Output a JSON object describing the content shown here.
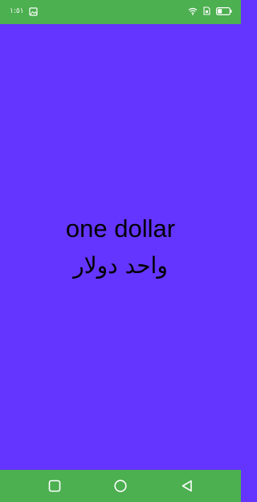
{
  "status_bar": {
    "time": "١:٥١",
    "icons": [
      "image-icon",
      "wifi-icon",
      "sim-card-icon",
      "battery-icon"
    ]
  },
  "main": {
    "english_text": "one dollar",
    "arabic_text": "واحد دولار"
  },
  "nav_bar": {
    "buttons": [
      "recents-square-icon",
      "home-circle-icon",
      "back-triangle-icon"
    ]
  },
  "colors": {
    "status_bar": "#4caf50",
    "background": "#6435ff",
    "nav_bar": "#4caf50",
    "text": "#000000"
  }
}
